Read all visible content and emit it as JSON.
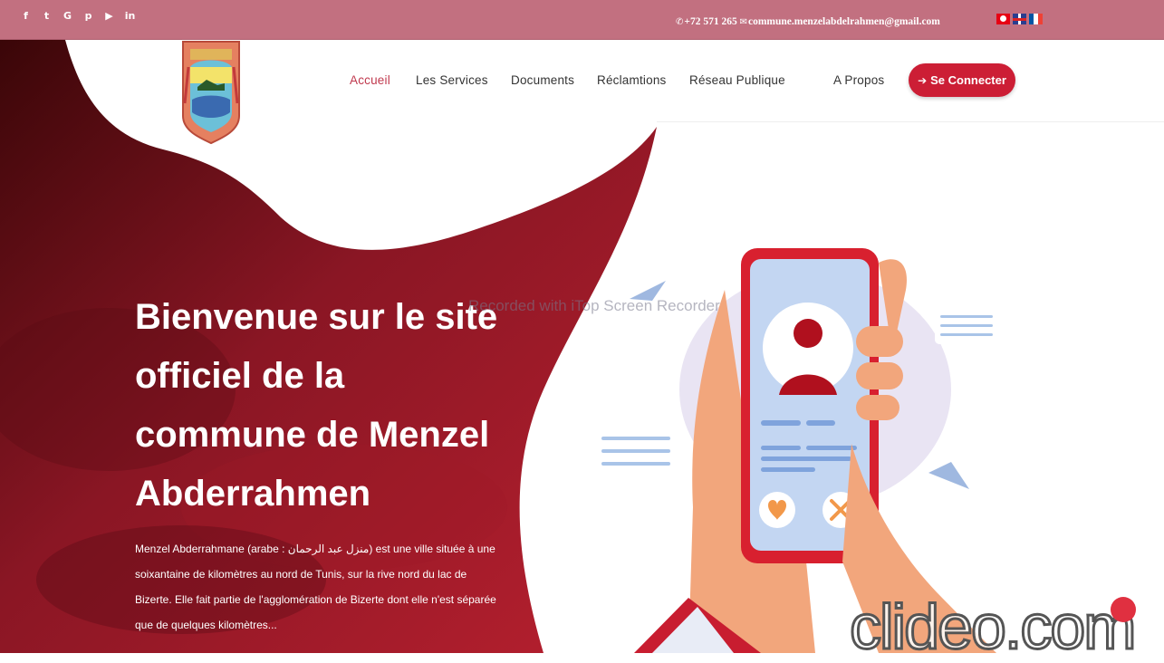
{
  "topbar": {
    "social_icons": [
      "facebook-icon",
      "twitter-icon",
      "google-icon",
      "pinterest-icon",
      "youtube-icon",
      "linkedin-icon"
    ],
    "social_glyphs": [
      "f",
      "t",
      "G",
      "p",
      "▶",
      "in"
    ],
    "phone": "+72 571 265",
    "email": "commune.menzelabdelrahmen@gmail.com",
    "languages": [
      "Arabic",
      "English",
      "French"
    ]
  },
  "nav": {
    "items": [
      "Accueil",
      "Les Services",
      "Documents",
      "Réclamtions",
      "Réseau Publique",
      "A Propos"
    ],
    "active": "Accueil",
    "connect_label": "Se Connecter"
  },
  "hero": {
    "title": "Bienvenue sur le site officiel de la commune de Menzel Abderrahmen",
    "text": "Menzel Abderrahmane (arabe : منزل عبد الرحمان) est une ville située à une soixantaine de kilomètres au nord de Tunis, sur la rive nord du lac de Bizerte. Elle fait partie de l'agglomération de Bizerte dont elle n'est séparée que de quelques kilomètres..."
  },
  "overlays": {
    "recorder_watermark": "Recorded with iTop Screen Recorder",
    "clideo_watermark": "clideo.com"
  },
  "colors": {
    "accent": "#cc1e35",
    "topbar": "#c27080",
    "hero_dark": "#7a0f1c"
  }
}
